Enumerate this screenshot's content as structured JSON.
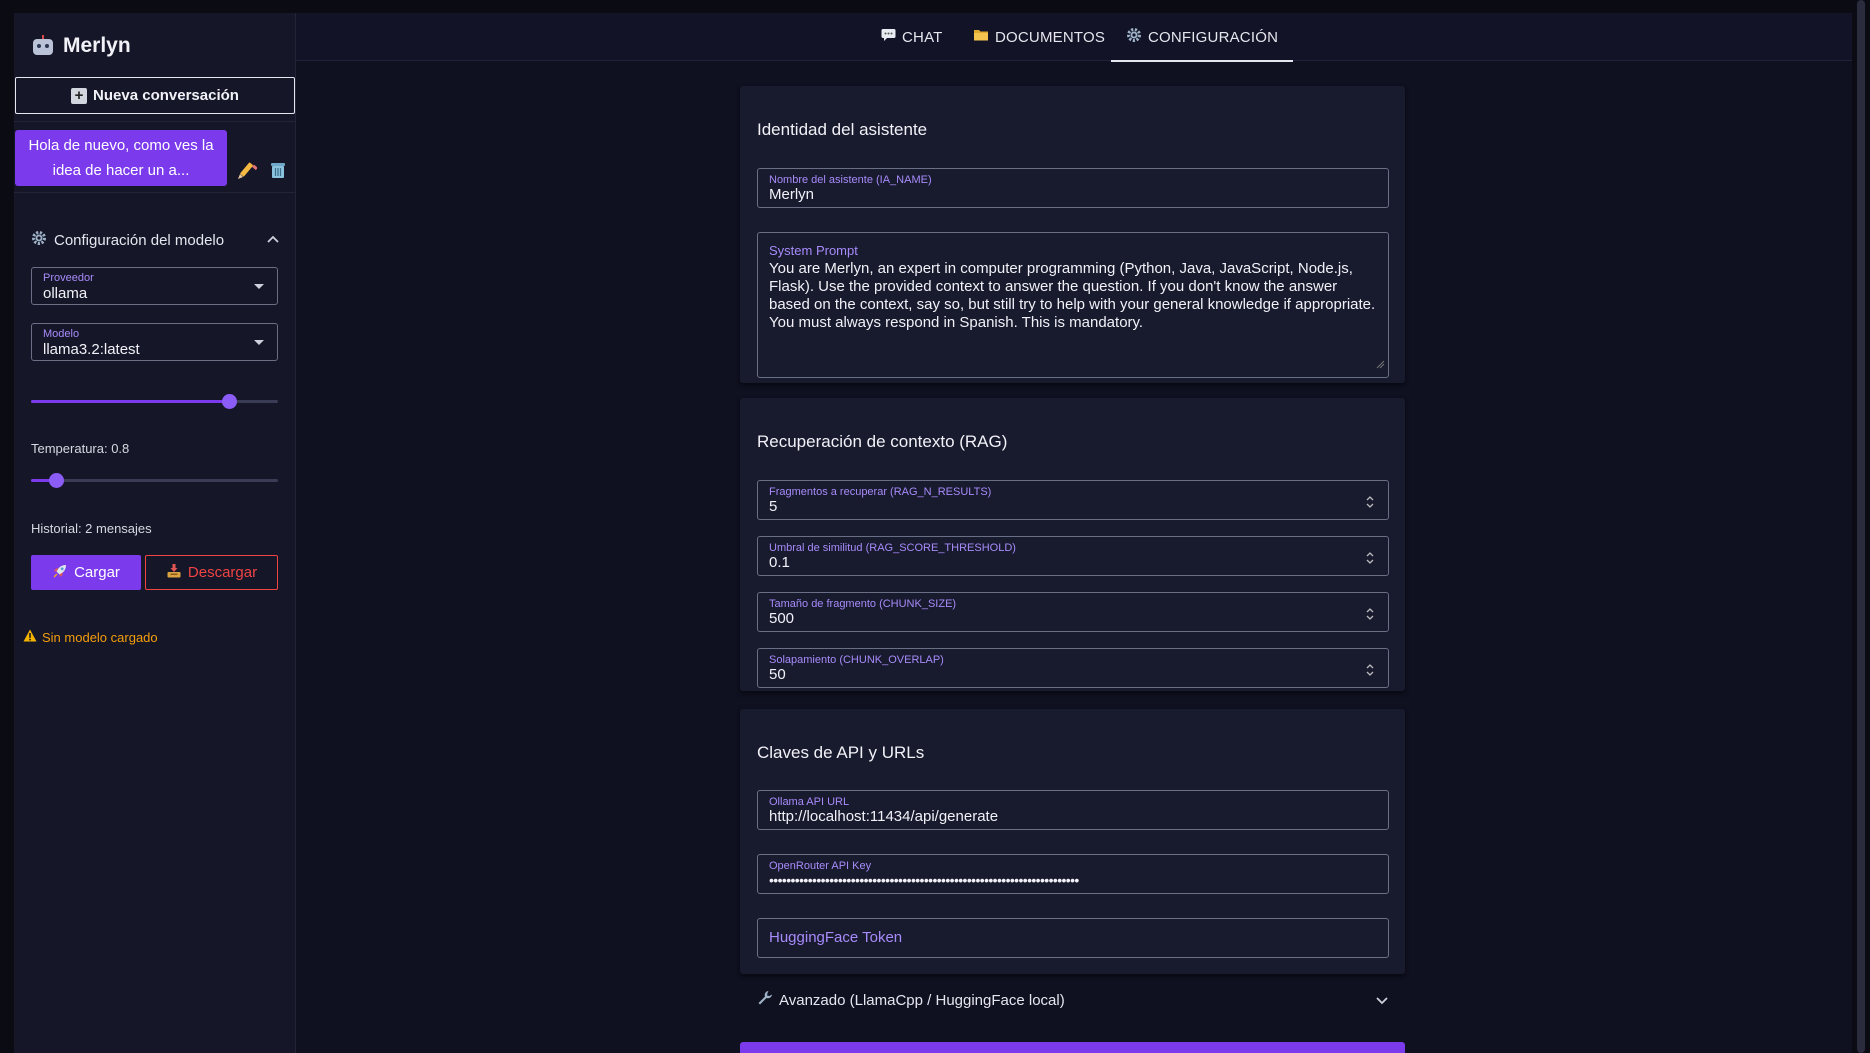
{
  "app": {
    "name": "Merlyn"
  },
  "sidebar": {
    "new_conversation": "Nueva conversación",
    "conversations": [
      {
        "title": "Hola de nuevo, como ves la idea de hacer un a..."
      }
    ],
    "model_section": {
      "title": "Configuración del modelo",
      "provider_label": "Proveedor",
      "provider_value": "ollama",
      "model_label": "Modelo",
      "model_value": "llama3.2:latest",
      "temperature_text": "Temperatura: 0.8",
      "temperature_value": 0.8,
      "history_text": "Historial: 2 mensajes",
      "history_value": 2,
      "load_button": "Cargar",
      "download_button": "Descargar",
      "status": "Sin modelo cargado"
    }
  },
  "tabs": [
    {
      "label": "CHAT",
      "icon": "speech-bubble-icon"
    },
    {
      "label": "DOCUMENTOS",
      "icon": "folder-icon"
    },
    {
      "label": "CONFIGURACIÓN",
      "icon": "gear-icon",
      "active": true
    }
  ],
  "identity": {
    "title": "Identidad del asistente",
    "name_label": "Nombre del asistente (IA_NAME)",
    "name_value": "Merlyn",
    "prompt_label": "System Prompt",
    "prompt_value": "You are Merlyn, an expert in computer programming (Python, Java, JavaScript, Node.js, Flask). Use the provided context to answer the question. If you don't know the answer based on the context, say so, but still try to help with your general knowledge if appropriate. You must always respond in Spanish. This is mandatory."
  },
  "rag": {
    "title": "Recuperación de contexto (RAG)",
    "fields": [
      {
        "label": "Fragmentos a recuperar (RAG_N_RESULTS)",
        "value": "5"
      },
      {
        "label": "Umbral de similitud (RAG_SCORE_THRESHOLD)",
        "value": "0.1"
      },
      {
        "label": "Tamaño de fragmento (CHUNK_SIZE)",
        "value": "500"
      },
      {
        "label": "Solapamiento (CHUNK_OVERLAP)",
        "value": "50"
      }
    ]
  },
  "api": {
    "title": "Claves de API y URLs",
    "ollama_label": "Ollama API URL",
    "ollama_value": "http://localhost:11434/api/generate",
    "openrouter_label": "OpenRouter API Key",
    "openrouter_value": "••••••••••••••••••••••••••••••••••••••••••••••••••••••••••••••••••••••••",
    "hf_placeholder": "HuggingFace Token"
  },
  "advanced": {
    "label": "Avanzado (LlamaCpp / HuggingFace local)"
  },
  "colors": {
    "accent": "#7c3aed",
    "danger": "#ef4444",
    "warning": "#f59e0b",
    "label": "#a78bfa"
  }
}
